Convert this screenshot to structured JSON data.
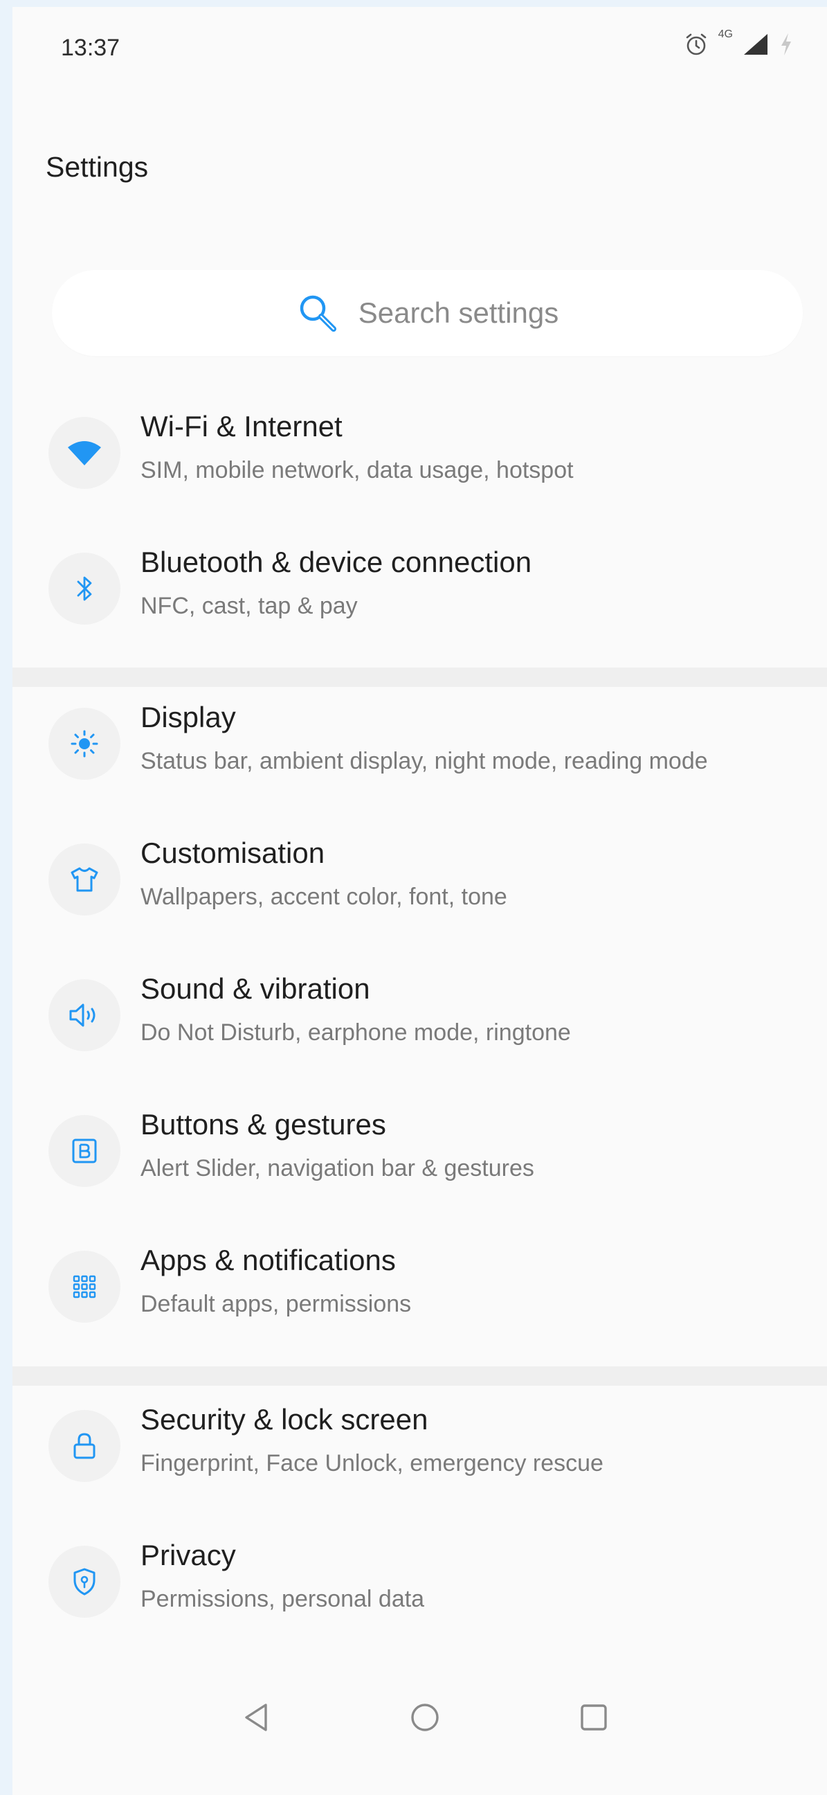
{
  "status_bar": {
    "time": "13:37",
    "network_label": "4G",
    "icons": [
      "alarm-icon",
      "signal-icon",
      "charging-icon"
    ]
  },
  "header": {
    "title": "Settings"
  },
  "search": {
    "placeholder": "Search settings"
  },
  "groups": [
    {
      "items": [
        {
          "title": "Wi-Fi & Internet",
          "subtitle": "SIM, mobile network, data usage, hotspot",
          "icon": "wifi-icon"
        },
        {
          "title": "Bluetooth & device connection",
          "subtitle": "NFC, cast, tap & pay",
          "icon": "bluetooth-icon"
        }
      ]
    },
    {
      "items": [
        {
          "title": "Display",
          "subtitle": "Status bar, ambient display, night mode, reading mode",
          "icon": "brightness-icon"
        },
        {
          "title": "Customisation",
          "subtitle": "Wallpapers, accent color, font, tone",
          "icon": "tshirt-icon"
        },
        {
          "title": "Sound & vibration",
          "subtitle": "Do Not Disturb, earphone mode, ringtone",
          "icon": "speaker-icon"
        },
        {
          "title": "Buttons & gestures",
          "subtitle": "Alert Slider, navigation bar & gestures",
          "icon": "button-b-icon"
        },
        {
          "title": "Apps & notifications",
          "subtitle": "Default apps, permissions",
          "icon": "apps-grid-icon"
        }
      ]
    },
    {
      "items": [
        {
          "title": "Security & lock screen",
          "subtitle": "Fingerprint, Face Unlock, emergency rescue",
          "icon": "lock-icon"
        },
        {
          "title": "Privacy",
          "subtitle": "Permissions, personal data",
          "icon": "shield-icon"
        }
      ]
    }
  ],
  "nav_bar": {
    "buttons": [
      "back-icon",
      "home-icon",
      "recents-icon"
    ]
  },
  "colors": {
    "accent": "#2196f3",
    "background": "#fafafa",
    "divider": "#efefef",
    "title_text": "#1f1f1f",
    "subtitle_text": "#7a7a7a"
  }
}
